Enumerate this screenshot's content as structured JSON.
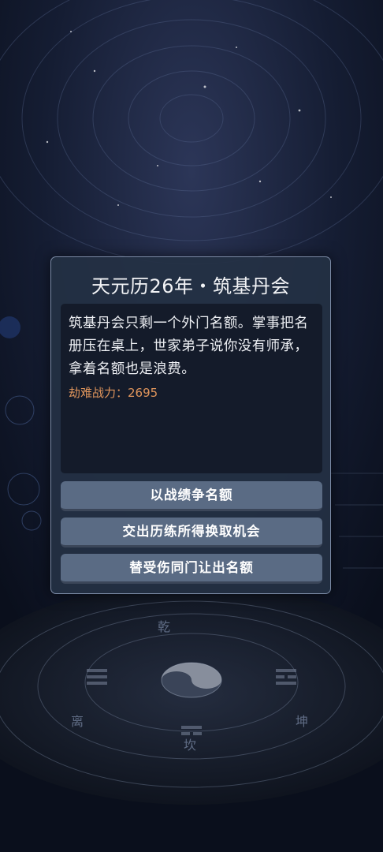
{
  "event": {
    "title": "天元历26年・筑基丹会",
    "description": "筑基丹会只剩一个外门名额。掌事把名册压在桌上，世家弟子说你没有师承，拿着名额也是浪费。",
    "power_label": "劫难战力：",
    "power_value": "2695"
  },
  "choices": [
    {
      "label": "以战绩争名额"
    },
    {
      "label": "交出历练所得换取机会"
    },
    {
      "label": "替受伤同门让出名额"
    }
  ],
  "background": {
    "bagua_glyphs": [
      "坎",
      "离",
      "坤",
      "乾"
    ]
  },
  "colors": {
    "panel": "#243044",
    "button": "#5a6b84",
    "power_text": "#e0955c"
  }
}
